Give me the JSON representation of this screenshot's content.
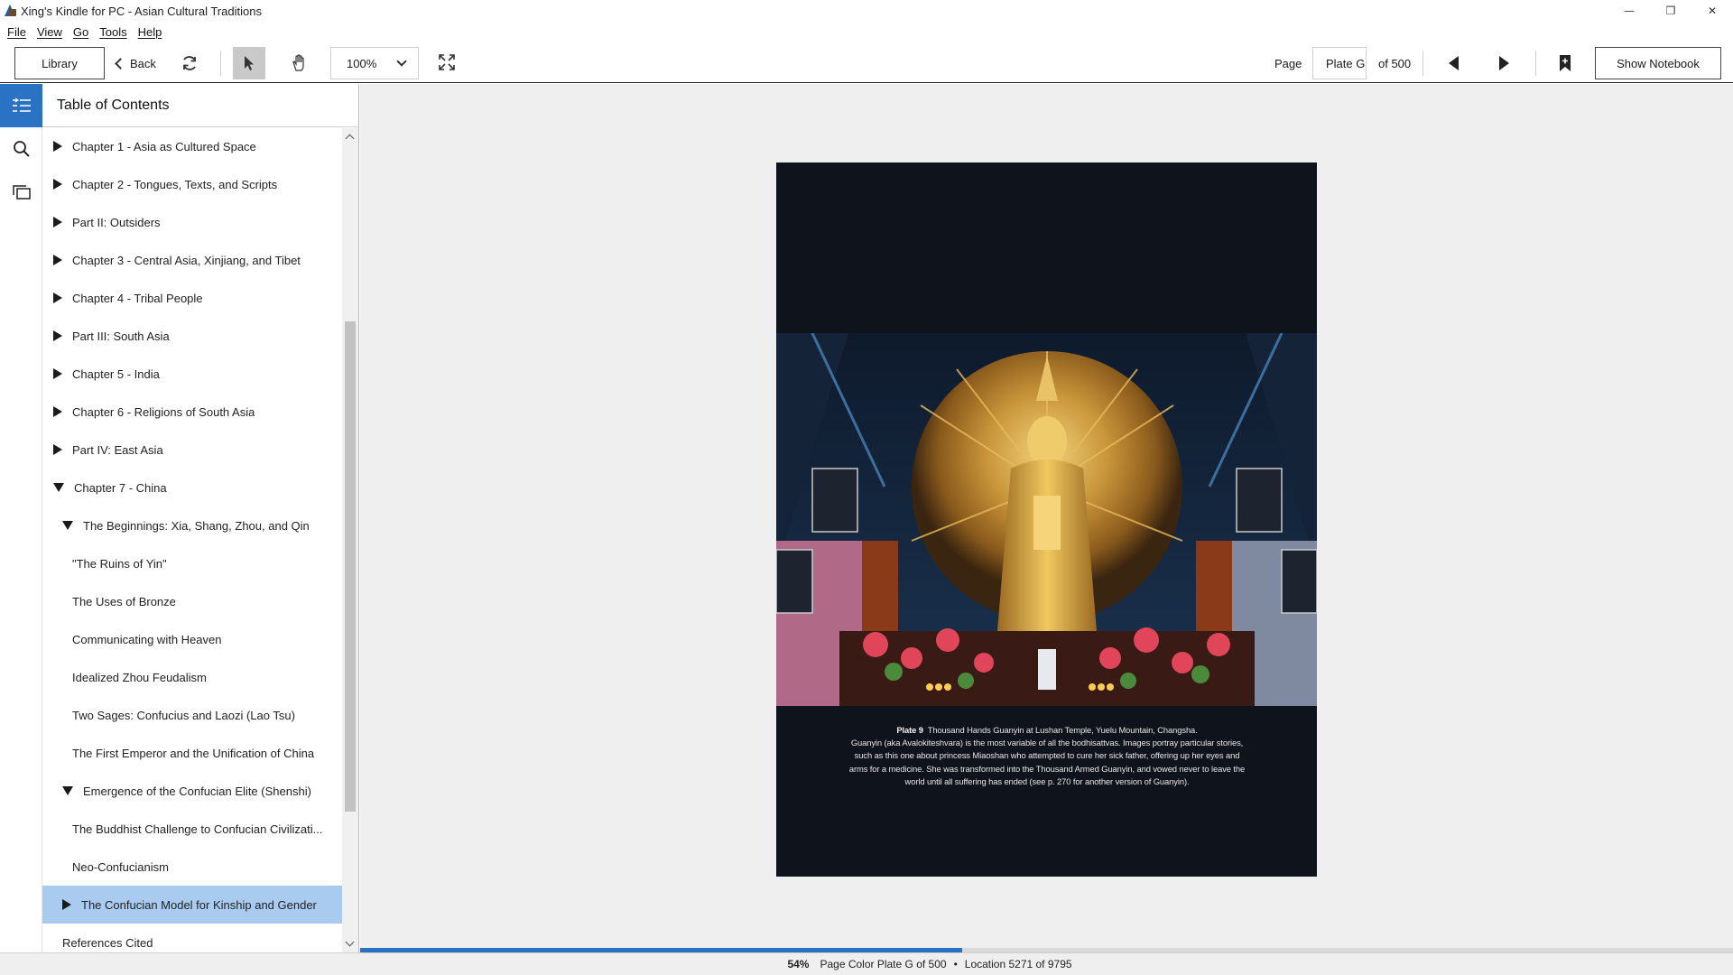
{
  "window": {
    "title": "Xing's Kindle for PC - Asian Cultural Traditions",
    "minimize_glyph": "—",
    "maximize_glyph": "❐",
    "close_glyph": "✕"
  },
  "menu": [
    "File",
    "View",
    "Go",
    "Tools",
    "Help"
  ],
  "toolbar": {
    "library_label": "Library",
    "back_label": "Back",
    "zoom_value": "100%",
    "page_label": "Page",
    "page_value": "Plate G",
    "page_of": "of 500",
    "notebook_label": "Show Notebook"
  },
  "icons": {
    "toc": "toc-icon",
    "search": "search-icon",
    "flashcards": "flashcards-icon",
    "sync": "sync-icon",
    "select": "pointer-icon",
    "hand": "hand-icon",
    "fullscreen": "fullscreen-icon",
    "prev": "prev-page-icon",
    "next": "next-page-icon",
    "bookmark": "bookmark-icon"
  },
  "colors": {
    "accent": "#2a72c4",
    "selected_row": "#a9cbef",
    "page_background": "#0f131c"
  },
  "toc": {
    "title": "Table of Contents",
    "items": [
      {
        "label": "Chapter 1 - Asia as Cultured Space",
        "state": "collapsed",
        "level": 0
      },
      {
        "label": "Chapter 2 - Tongues, Texts, and Scripts",
        "state": "collapsed",
        "level": 0
      },
      {
        "label": "Part II: Outsiders",
        "state": "collapsed",
        "level": 0
      },
      {
        "label": "Chapter 3 - Central Asia, Xinjiang, and Tibet",
        "state": "collapsed",
        "level": 0
      },
      {
        "label": "Chapter 4 - Tribal People",
        "state": "collapsed",
        "level": 0
      },
      {
        "label": "Part III: South Asia",
        "state": "collapsed",
        "level": 0
      },
      {
        "label": "Chapter 5 - India",
        "state": "collapsed",
        "level": 0
      },
      {
        "label": "Chapter 6 - Religions of South Asia",
        "state": "collapsed",
        "level": 0
      },
      {
        "label": "Part IV: East Asia",
        "state": "collapsed",
        "level": 0
      },
      {
        "label": "Chapter 7 - China",
        "state": "expanded",
        "level": 0
      },
      {
        "label": "The Beginnings: Xia, Shang, Zhou, and Qin",
        "state": "expanded",
        "level": 1
      },
      {
        "label": "\"The Ruins of Yin\"",
        "state": "leaf",
        "level": 2
      },
      {
        "label": "The Uses of Bronze",
        "state": "leaf",
        "level": 2
      },
      {
        "label": "Communicating with Heaven",
        "state": "leaf",
        "level": 2
      },
      {
        "label": "Idealized Zhou Feudalism",
        "state": "leaf",
        "level": 2
      },
      {
        "label": "Two Sages: Confucius and Laozi (Lao Tsu)",
        "state": "leaf",
        "level": 2
      },
      {
        "label": "The First Emperor and the Unification of China",
        "state": "leaf",
        "level": 2
      },
      {
        "label": "Emergence of the Confucian Elite (Shenshi)",
        "state": "expanded",
        "level": 1
      },
      {
        "label": "The Buddhist Challenge to Confucian Civilizati...",
        "state": "leaf",
        "level": 2
      },
      {
        "label": "Neo-Confucianism",
        "state": "leaf",
        "level": 2
      },
      {
        "label": "The Confucian Model for Kinship and Gender",
        "state": "collapsed",
        "level": 1,
        "selected": true
      },
      {
        "label": "References Cited",
        "state": "leaf",
        "level": 1
      }
    ]
  },
  "page": {
    "caption_bold": "Plate 9",
    "caption_title": "Thousand Hands Guanyin at Lushan Temple, Yuelu Mountain, Changsha.",
    "caption_body": "Guanyin (aka Avalokiteshvara) is the most variable of all the bodhisattvas. Images portray particular stories, such as this one about princess Miaoshan who attempted to cure her sick father, offering up her eyes and arms for a medicine. She was transformed into the Thousand Armed Guanyin, and vowed never to leave the world until all suffering has ended (see p. 270 for another version of Guanyin)."
  },
  "progress": {
    "fraction": 0.54
  },
  "status": {
    "percent": "54%",
    "page_text": "Page Color Plate G of 500",
    "separator": "•",
    "location_text": "Location 5271 of 9795"
  }
}
